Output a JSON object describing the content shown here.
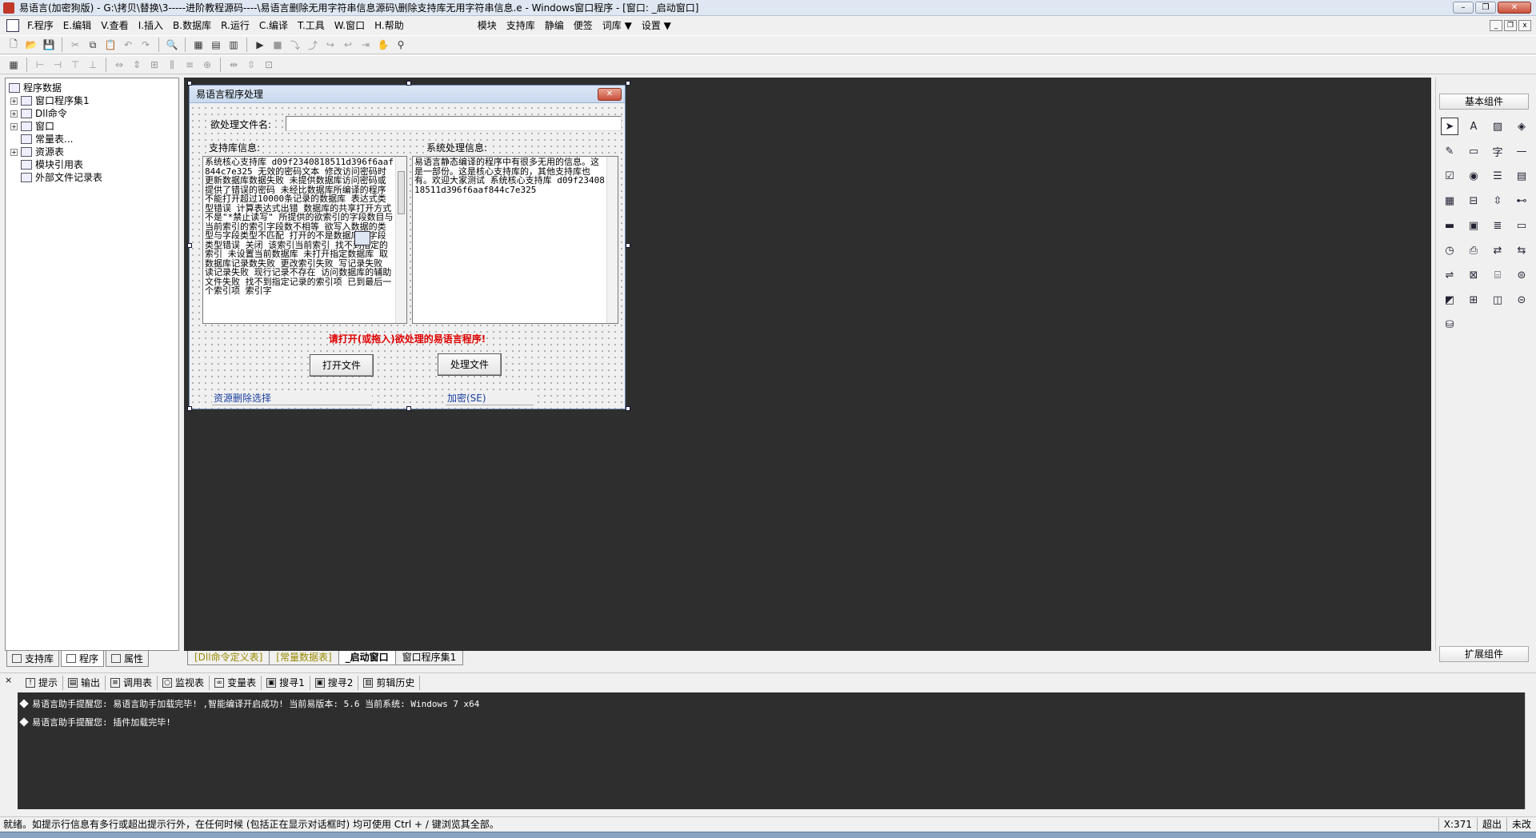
{
  "window": {
    "title": "易语言(加密狗版) - G:\\拷贝\\替换\\3-----进阶教程源码----\\易语言删除无用字符串信息源码\\删除支持库无用字符串信息.e - Windows窗口程序 - [窗口: _启动窗口]",
    "minimize": "–",
    "restore": "❐",
    "close": "✕"
  },
  "menu": {
    "items": [
      "F.程序",
      "E.编辑",
      "V.查看",
      "I.插入",
      "B.数据库",
      "R.运行",
      "C.编译",
      "T.工具",
      "W.窗口",
      "H.帮助"
    ],
    "extra": [
      "模块",
      "支持库",
      "静编",
      "便签",
      "词库 ▼",
      "设置 ▼"
    ],
    "mdi_min": "_",
    "mdi_restore": "❐",
    "mdi_close": "x"
  },
  "left_panel": {
    "root": "程序数据",
    "items": [
      "窗口程序集1",
      "Dll命令",
      "窗口",
      "常量表...",
      "资源表",
      "模块引用表",
      "外部文件记录表"
    ],
    "tabs": [
      "支持库",
      "程序",
      "属性"
    ]
  },
  "designer": {
    "caption": "易语言程序处理",
    "file_label": "欲处理文件名:",
    "file_value": "",
    "support_label": "支持库信息:",
    "system_label": "系统处理信息:",
    "support_text": "系统核心支持库 d09f2340818511d396f6aaf844c7e325 无效的密码文本  修改访问密码时更新数据库数据失败    未提供数据库访问密码或提供了错误的密码  未经比数据库所编译的程序不能打开超过10000条记录的数据库 表达式类型错误 计算表达式出错  数据库的共享打开方式不是\"*禁止读写\"   所提供的欲索引的字段数目与当前索引的索引字段数不相等  欲写入数据的类型与字段类型不匹配  打开的不是数据库或字段类型错误  关闭 该索引当前索引  找不到指定的索引  未设置当前数据库  未打开指定数据库  取数据库记录数失败 更改索引失败  写记录失败 读记录失败  现行记录不存在 访问数据库的辅助文件失败  找不到指定记录的索引项 已到最后一个索引项 索引字",
    "system_text": "易语言静态编译的程序中有很多无用的信息。这是一部份。这是核心支持库的，其他支持库也有。欢迎大家测试 系统核心支持库 d09f2340818511d396f6aaf844c7e325",
    "warning": "请打开(或拖入)欲处理的易语言程序!",
    "open_button": "打开文件",
    "process_button": "处理文件",
    "group_left": "资源删除选择",
    "group_right": "加密(SE)"
  },
  "doc_tabs": [
    "[Dll命令定义表]",
    "[常量数据表]",
    "_启动窗口",
    "窗口程序集1"
  ],
  "right_panel": {
    "top": "基本组件",
    "bottom": "扩展组件",
    "icons": [
      "arrow-icon",
      "label-icon",
      "picture-icon",
      "shape-icon",
      "edit-icon",
      "frame-icon",
      "text-icon",
      "line-icon",
      "checkbox-icon",
      "radio-icon",
      "listbox-icon",
      "combo-icon",
      "grid-icon",
      "tab-icon",
      "scrollbar-icon",
      "slider-icon",
      "progress-icon",
      "date-icon",
      "menu-icon",
      "status-icon",
      "timer-icon",
      "printer-icon",
      "server-icon",
      "client-icon",
      "port-icon",
      "net-icon",
      "db-icon",
      "odbc-icon",
      "chart-icon",
      "table-icon",
      "media-icon",
      "odbc2-icon",
      "datasource-icon"
    ]
  },
  "output_tabs": [
    "提示",
    "输出",
    "调用表",
    "监视表",
    "变量表",
    "搜寻1",
    "搜寻2",
    "剪辑历史"
  ],
  "output_lines": [
    "易语言助手提醒您: 易语言助手加载完毕!  ,智能编译开启成功!  当前易版本: 5.6  当前系统: Windows 7 x64",
    "易语言助手提醒您: 插件加载完毕!"
  ],
  "status": {
    "text": "就绪。如提示行信息有多行或超出提示行外，在任何时候 (包括正在显示对话框时) 均可使用 Ctrl + / 键浏览其全部。",
    "coord": "X:371",
    "mode": "超出",
    "state": "未改"
  }
}
